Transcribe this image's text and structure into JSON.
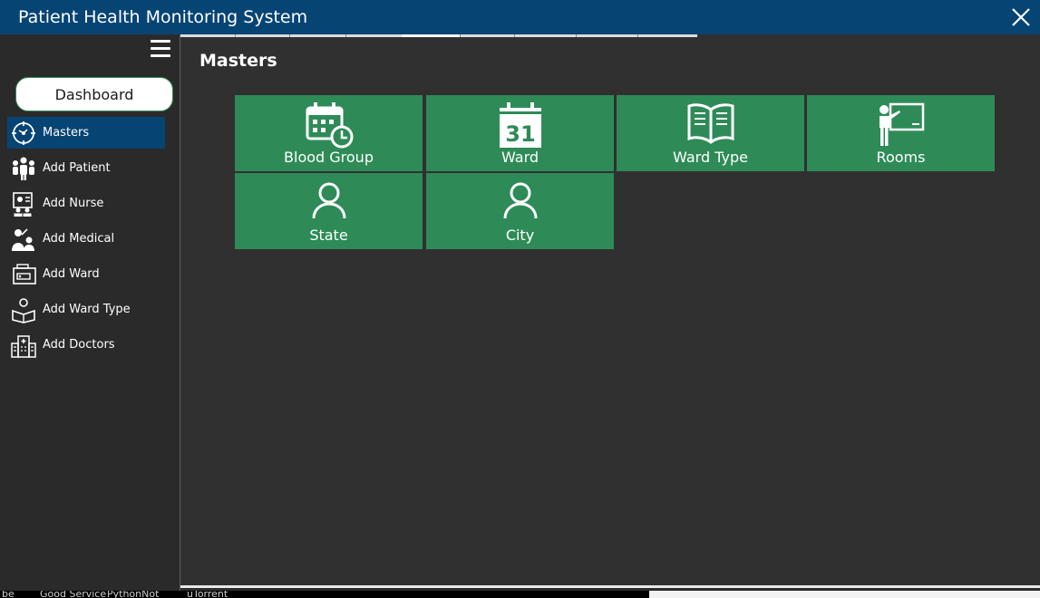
{
  "window": {
    "title": "Patient Health Monitoring System"
  },
  "sidebar": {
    "dashboard_label": "Dashboard",
    "items": [
      {
        "label": "Masters",
        "icon": "masters-icon",
        "active": true
      },
      {
        "label": "Add  Patient",
        "icon": "patients-icon"
      },
      {
        "label": "Add Nurse",
        "icon": "nurse-icon"
      },
      {
        "label": "Add Medical",
        "icon": "medical-icon"
      },
      {
        "label": "Add Ward",
        "icon": "ward-icon"
      },
      {
        "label": "Add Ward Type",
        "icon": "ward-type-icon"
      },
      {
        "label": "Add Doctors",
        "icon": "hospital-icon"
      }
    ]
  },
  "main": {
    "title": "Masters",
    "tiles": [
      {
        "label": "Blood Group",
        "icon": "calendar-clock-icon"
      },
      {
        "label": "Ward",
        "icon": "calendar-31-icon",
        "icon_text": "31"
      },
      {
        "label": "Ward Type",
        "icon": "book-icon"
      },
      {
        "label": "Rooms",
        "icon": "teacher-board-icon"
      },
      {
        "label": "State",
        "icon": "user-icon"
      },
      {
        "label": "City",
        "icon": "user-icon"
      }
    ]
  },
  "taskbar": {
    "items": [
      "be",
      "Good Service",
      "PythonNot",
      "uTorrent"
    ]
  },
  "colors": {
    "titlebar": "#064474",
    "accent": "#2e8b57",
    "active_nav": "#064474",
    "background": "#303030"
  }
}
